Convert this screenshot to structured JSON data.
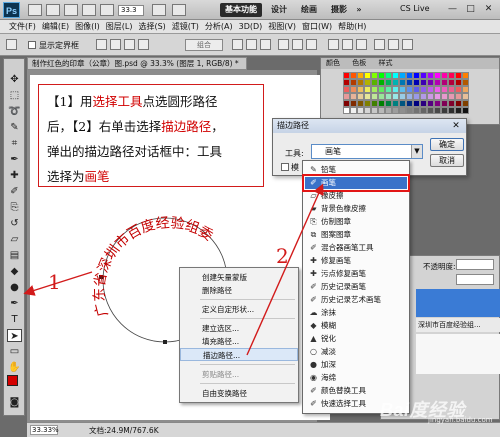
{
  "titlebar": {
    "logo": "Ps",
    "zoom": "33.3",
    "workspaces": [
      "基本功能",
      "设计",
      "绘画",
      "摄影",
      "»"
    ],
    "cs_live": "CS Live",
    "win_min": "—",
    "win_max": "□",
    "win_close": "✕"
  },
  "menubar": [
    "文件(F)",
    "编辑(E)",
    "图像(I)",
    "图层(L)",
    "选择(S)",
    "滤镜(T)",
    "分析(A)",
    "3D(D)",
    "视图(V)",
    "窗口(W)",
    "帮助(H)"
  ],
  "options": {
    "show_bbox_label": "显示定界框",
    "group_label": "组合"
  },
  "document": {
    "tab_title": "制作红色的印章（公章）图.psd @ 33.3% (图层 1, RGB/8) * ✕",
    "status_zoom": "33.33%",
    "status_doc": "文档:24.9M/767.6K"
  },
  "annotation": {
    "line1_a": "【1】用",
    "line1_b": "选择工具",
    "line1_c": "点选圆形路径",
    "line2_a": "后，【2】右单击选择",
    "line2_b": "描边路径",
    "line2_c": "，",
    "line3": "弹出的描边路径对话框中：工具",
    "line4_a": "选择为",
    "line4_b": "画笔"
  },
  "seal_text": "广东省深圳市百度经验组委",
  "context_menu": {
    "items": [
      {
        "label": "创建矢量蒙版",
        "disabled": false
      },
      {
        "label": "删除路径",
        "disabled": false
      },
      {
        "label": "定义自定形状...",
        "disabled": false
      },
      {
        "label": "建立选区...",
        "disabled": false
      },
      {
        "label": "填充路径...",
        "disabled": false
      },
      {
        "label": "描边路径...",
        "disabled": false,
        "selected": true
      },
      {
        "label": "剪贴路径...",
        "disabled": true
      },
      {
        "label": "自由变换路径",
        "disabled": false
      }
    ]
  },
  "swatches_panel": {
    "tabs": [
      "颜色",
      "色板",
      "样式"
    ]
  },
  "layers_panel": {
    "opacity_label": "不透明度:",
    "layer_name": "深圳市百度经验组..."
  },
  "stroke_dialog": {
    "title": "描边路径",
    "close": "✕",
    "tool_label": "工具:",
    "tool_value": "画笔",
    "simulate_label": "模",
    "ok": "确定",
    "cancel": "取消"
  },
  "tool_list": [
    {
      "icon": "✎",
      "label": "铅笔"
    },
    {
      "icon": "✐",
      "label": "画笔",
      "highlighted": true
    },
    {
      "icon": "▱",
      "label": "橡皮擦"
    },
    {
      "icon": "▰",
      "label": "背景色橡皮擦"
    },
    {
      "icon": "⎘",
      "label": "仿制图章"
    },
    {
      "icon": "⧉",
      "label": "图案图章"
    },
    {
      "icon": "✐",
      "label": "混合器画笔工具"
    },
    {
      "icon": "✚",
      "label": "修复画笔"
    },
    {
      "icon": "✚",
      "label": "污点修复画笔"
    },
    {
      "icon": "✐",
      "label": "历史记录画笔"
    },
    {
      "icon": "✐",
      "label": "历史记录艺术画笔"
    },
    {
      "icon": "☁",
      "label": "涂抹"
    },
    {
      "icon": "◆",
      "label": "模糊"
    },
    {
      "icon": "▲",
      "label": "锐化"
    },
    {
      "icon": "○",
      "label": "减淡"
    },
    {
      "icon": "●",
      "label": "加深"
    },
    {
      "icon": "◉",
      "label": "海绵"
    },
    {
      "icon": "✐",
      "label": "颜色替换工具"
    },
    {
      "icon": "✐",
      "label": "快速选择工具"
    }
  ],
  "steps": {
    "one": "1",
    "two": "2"
  },
  "watermark": "Bai度经验",
  "watermark_sub": "jingyan.baidu.com",
  "colors": {
    "accent_red": "#d21b1b",
    "foreground": "#d40000",
    "highlight_blue": "#3a72c9"
  }
}
